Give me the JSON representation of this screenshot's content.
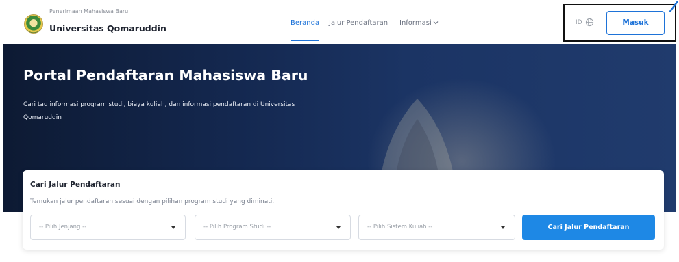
{
  "brand": {
    "subtitle": "Penerimaan Mahasiswa Baru",
    "title": "Universitas Qomaruddin",
    "logo_icon": "university-seal"
  },
  "nav": {
    "items": [
      {
        "label": "Beranda",
        "active": true
      },
      {
        "label": "Jalur Pendaftaran",
        "active": false
      },
      {
        "label": "Informasi",
        "active": false
      }
    ]
  },
  "header": {
    "language": "ID",
    "login_label": "Masuk"
  },
  "hero": {
    "title": "Portal Pendaftaran Mahasiswa Baru",
    "description": "Cari tau informasi program studi, biaya kuliah, dan informasi pendaftaran di Universitas Qomaruddin"
  },
  "search": {
    "title": "Cari Jalur Pendaftaran",
    "subtitle": "Temukan jalur pendaftaran sesuai dengan pilihan program studi yang diminati.",
    "jenjang_placeholder": "-- Pilih Jenjang --",
    "prodi_placeholder": "-- Pilih Program Studi --",
    "sistem_placeholder": "-- Pilih Sistem Kuliah --",
    "button_label": "Cari Jalur Pendaftaran"
  },
  "colors": {
    "primary": "#1e73d8",
    "button": "#1e88e5",
    "hero_bg": "#142850"
  }
}
